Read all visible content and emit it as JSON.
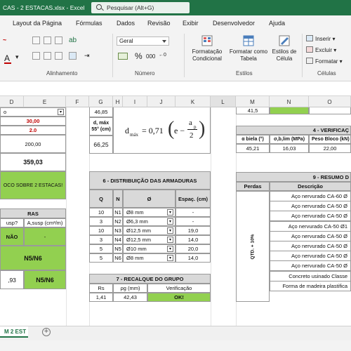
{
  "titlebar": {
    "title": "CAS - 2 ESTACAS.xlsx  -  Excel",
    "search_placeholder": "Pesquisar (Alt+G)"
  },
  "menu": {
    "tabs": [
      "Layout da Página",
      "Fórmulas",
      "Dados",
      "Revisão",
      "Exibir",
      "Desenvolvedor",
      "Ajuda"
    ]
  },
  "ribbon": {
    "number_format": "Geral",
    "groups": {
      "alignment": "Alinhamento",
      "number": "Número",
      "styles": "Estilos",
      "cells": "Células"
    },
    "buttons": {
      "conditional_format": "Formatação\nCondicional",
      "format_as_table": "Formatar como\nTabela",
      "cell_styles": "Estilos de\nCélula",
      "insert": "Inserir",
      "delete": "Excluir",
      "format": "Formatar"
    },
    "percent": "%",
    "thousands": "000"
  },
  "columns": [
    "D",
    "E",
    "F",
    "G",
    "H",
    "I",
    "J",
    "K",
    "L",
    "M",
    "N",
    "O"
  ],
  "left_block": {
    "select_value": "o",
    "val1": "30,00",
    "val2": "2.0",
    "val3": "200,00",
    "val4": "359,03",
    "green_text": "OCO SOBRE 2 ESTACAS!",
    "section_title": "RAS",
    "hdr_susp": "usp?",
    "hdr_asusp": "A,susp (cm²/m)",
    "nao": "NÃO",
    "dash": "-",
    "n5n6": "N5/N6",
    "last_val": ",93",
    "last_n5n6": "N5/N6"
  },
  "dmax": {
    "header": "d, máx\n55° (cm)",
    "top_cut": "46,85",
    "value": "66,25",
    "formula_lhs": "d",
    "formula_sub": "máx",
    "formula_eq": "= 0,71",
    "formula_e": "e −",
    "formula_ap": "a",
    "formula_ap_sub": "p",
    "formula_den": "2"
  },
  "dist": {
    "title": "6 - DISTRIBUIÇÃO DAS ARMADURAS",
    "headers": [
      "Q",
      "N",
      "Ø",
      "Espaç. (cm)"
    ],
    "rows": [
      {
        "q": "10",
        "n": "N1",
        "d": "Ø8 mm",
        "e": "-"
      },
      {
        "q": "3",
        "n": "N2",
        "d": "Ø6,3 mm",
        "e": "-"
      },
      {
        "q": "10",
        "n": "N3",
        "d": "Ø12,5 mm",
        "e": "19,0"
      },
      {
        "q": "3",
        "n": "N4",
        "d": "Ø12,5 mm",
        "e": "14,0"
      },
      {
        "q": "5",
        "n": "N5",
        "d": "Ø10 mm",
        "e": "20,0"
      },
      {
        "q": "5",
        "n": "N6",
        "d": "Ø8 mm",
        "e": "14,0"
      }
    ]
  },
  "recalque": {
    "title": "7 - RECALQUE DO GRUPO",
    "headers": [
      "Rs",
      "ρg (mm)",
      "Verificação"
    ],
    "values": [
      "1,41",
      "42,43",
      "OK!"
    ]
  },
  "verif": {
    "top_cut": "41,5",
    "title": "4 - VERIFICAÇ",
    "headers": [
      "α biela (°)",
      "σ,b,lim (MPa)",
      "Peso Bloco (kN)"
    ],
    "values": [
      "45,21",
      "16,03",
      "22,00"
    ]
  },
  "resumo": {
    "title": "9 - RESUMO D",
    "headers": [
      "Perdas",
      "Descrição"
    ],
    "side_label": "QTD. + 10%",
    "items": [
      "Aço nervurado CA-60 Ø",
      "Aço nervurado CA-50 Ø",
      "Aço nervurado CA-50 Ø",
      "Aço nervurado CA-50 Ø1",
      "Aço nervurado CA-50 Ø",
      "Aço nervurado CA-50 Ø",
      "Aço nervurado CA-50 Ø",
      "Aço nervurado CA-50 Ø",
      "Concreto usinado Classe",
      "Forma de madeira plastifica"
    ]
  },
  "sheettab": "M 2 EST",
  "colors": {
    "excel_green": "#217346",
    "cell_green": "#92d050",
    "header_gray": "#d9d9d9",
    "red_value": "#c00000"
  }
}
